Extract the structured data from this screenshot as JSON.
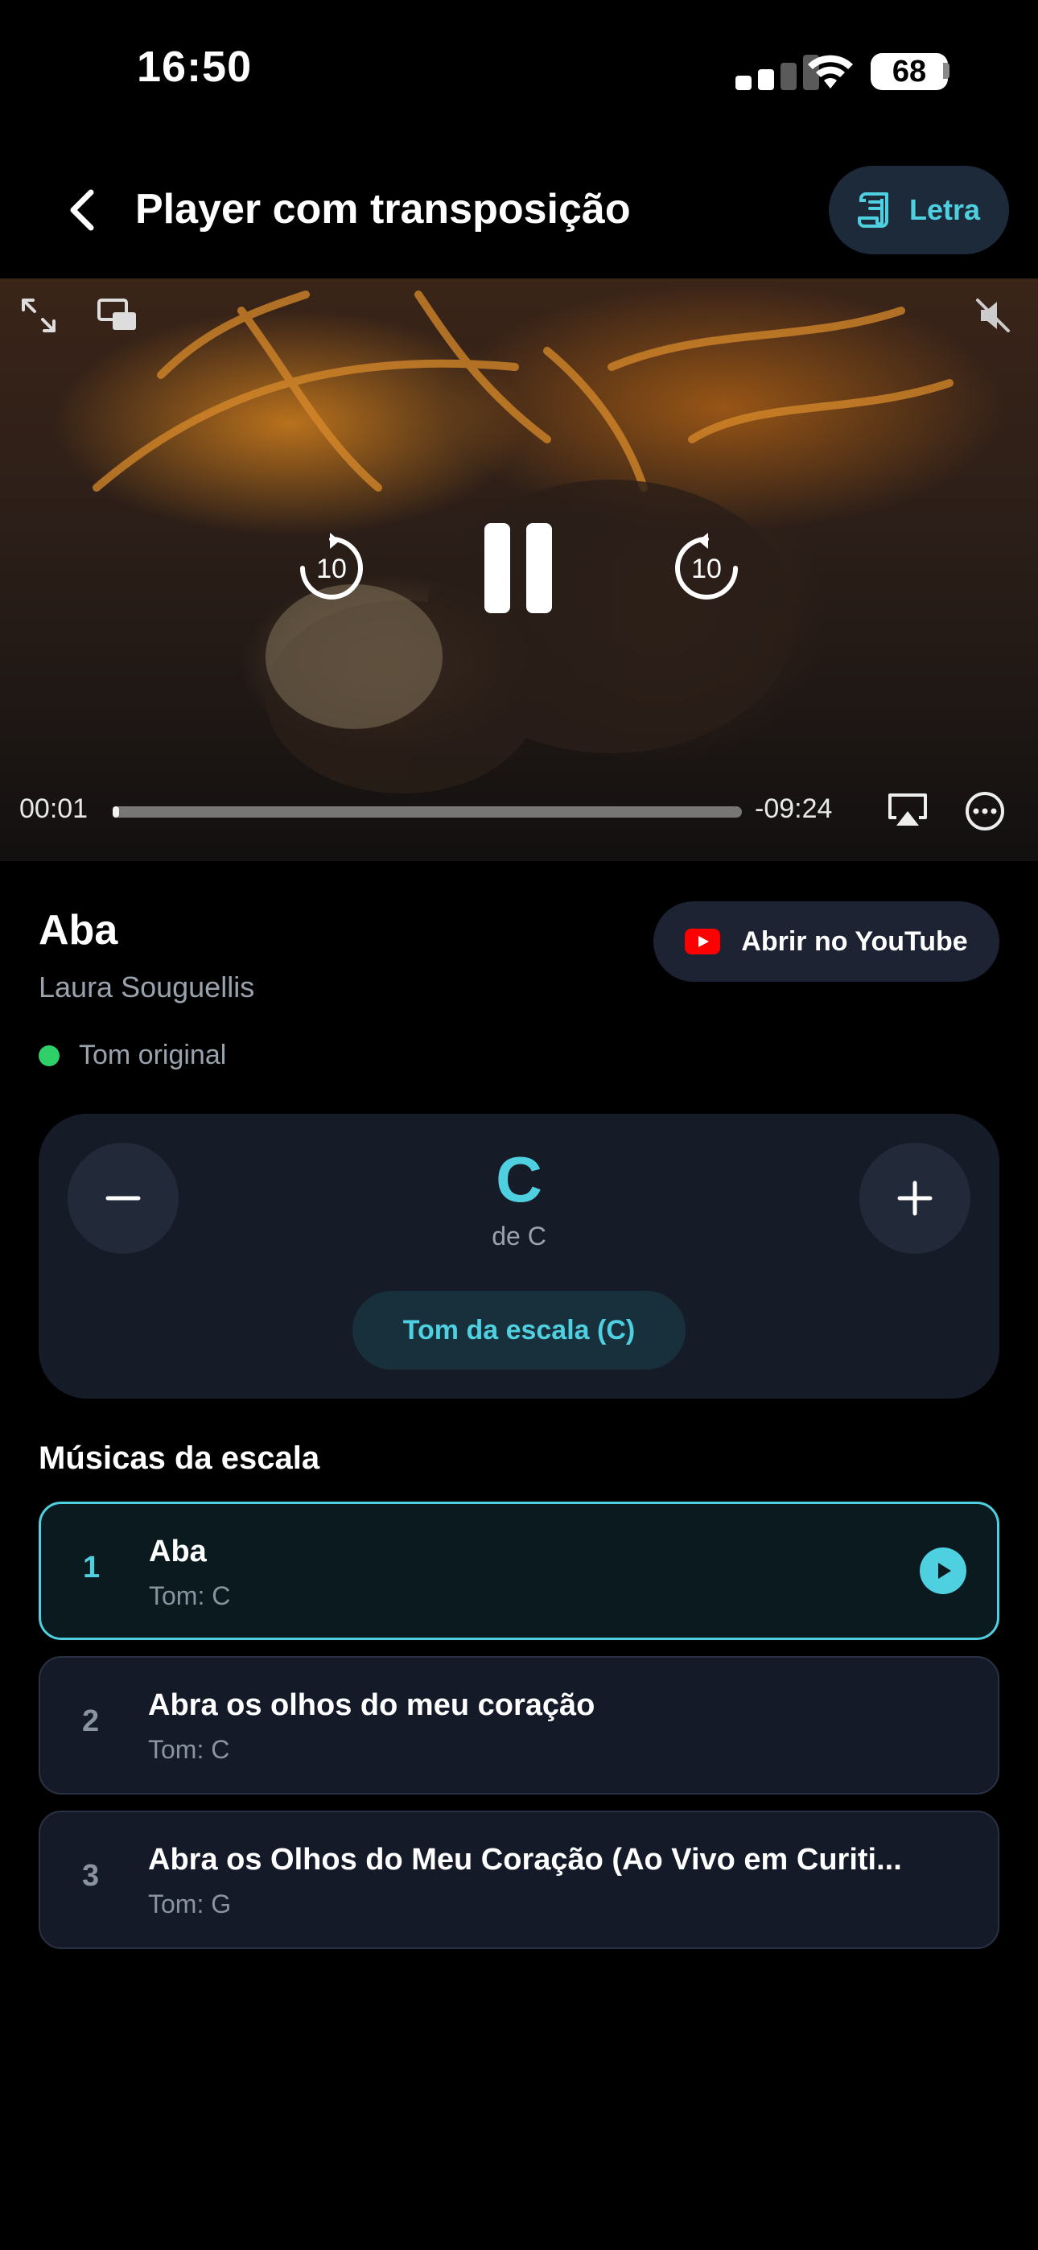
{
  "status_bar": {
    "time": "16:50",
    "battery_level": "68"
  },
  "header": {
    "title": "Player com transposição",
    "lyrics_label": "Letra"
  },
  "video": {
    "current_time": "00:01",
    "remaining_time": "-09:24",
    "progress": 0.002,
    "skip_back_seconds": "10",
    "skip_forward_seconds": "10"
  },
  "song": {
    "title": "Aba",
    "artist": "Laura Souguellis",
    "tone_status": "Tom original",
    "youtube_label": "Abrir no YouTube"
  },
  "transpose": {
    "key": "C",
    "from": "de C",
    "scale_button": "Tom da escala (C)",
    "minus": "−",
    "plus": "+"
  },
  "list": {
    "title": "Músicas da escala",
    "items": [
      {
        "num": "1",
        "name": "Aba",
        "tom": "Tom: C",
        "active": true
      },
      {
        "num": "2",
        "name": "Abra os olhos do meu coração",
        "tom": "Tom: C",
        "active": false
      },
      {
        "num": "3",
        "name": "Abra os Olhos do Meu Coração (Ao Vivo em Curiti...",
        "tom": "Tom: G",
        "active": false
      }
    ]
  },
  "colors": {
    "accent": "#4fd0e0",
    "status_green": "#2fd06a",
    "youtube_red": "#ff0000",
    "card_bg": "#161b28"
  }
}
